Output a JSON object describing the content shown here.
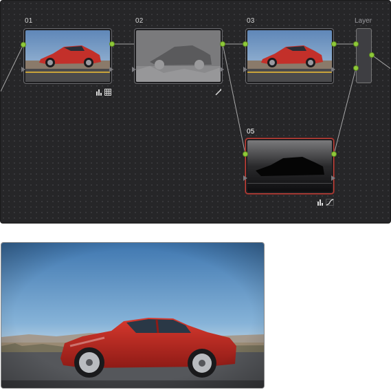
{
  "node_editor": {
    "nodes": [
      {
        "id": "01",
        "label": "01",
        "type": "color-corrector",
        "thumbnail": "red-coupe"
      },
      {
        "id": "02",
        "label": "02",
        "type": "color-corrector",
        "thumbnail": "car-matte-gray"
      },
      {
        "id": "03",
        "label": "03",
        "type": "color-corrector",
        "thumbnail": "red-coupe"
      },
      {
        "id": "05",
        "label": "05",
        "type": "color-corrector",
        "thumbnail": "car-matte-dark",
        "selected": true
      }
    ],
    "layer_node": {
      "label": "Layer"
    },
    "badges": {
      "node01": [
        "bars-icon",
        "grid-icon"
      ],
      "node02": [
        "pen-icon"
      ],
      "node05": [
        "bars-icon",
        "curves-icon"
      ]
    },
    "colors": {
      "background": "#262628",
      "connector": "#a0a0a0",
      "port": "#8fc93a",
      "selection": "#c8443c"
    }
  },
  "viewer": {
    "content": "red-coupe-full-frame"
  }
}
